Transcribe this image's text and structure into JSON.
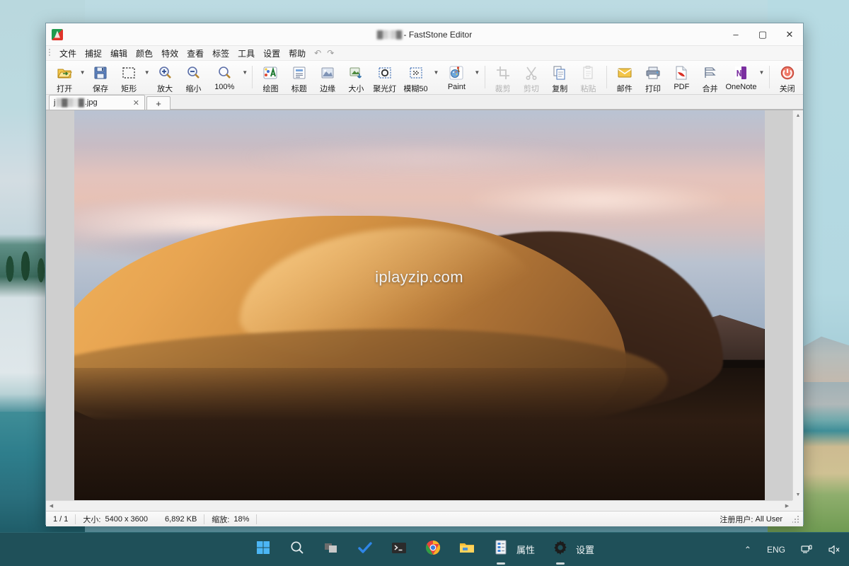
{
  "window": {
    "title_prefix_blurred": "▓▒░▒▓",
    "title": "- FastStone Editor",
    "app_icon": "faststone-logo-icon",
    "minimize": "–",
    "maximize": "▢",
    "close": "✕"
  },
  "menubar": {
    "items": [
      {
        "label": "文件",
        "name": "menu-file"
      },
      {
        "label": "捕捉",
        "name": "menu-capture"
      },
      {
        "label": "编辑",
        "name": "menu-edit"
      },
      {
        "label": "颜色",
        "name": "menu-color"
      },
      {
        "label": "特效",
        "name": "menu-effects"
      },
      {
        "label": "查看",
        "name": "menu-view"
      },
      {
        "label": "标签",
        "name": "menu-tabs"
      },
      {
        "label": "工具",
        "name": "menu-tools"
      },
      {
        "label": "设置",
        "name": "menu-settings"
      },
      {
        "label": "帮助",
        "name": "menu-help"
      }
    ],
    "undo": "↶",
    "redo": "↷"
  },
  "toolbar": {
    "items": [
      {
        "label": "打开",
        "icon": "open-folder-icon",
        "caret": true,
        "disabled": false
      },
      {
        "label": "保存",
        "icon": "save-disk-icon",
        "caret": false,
        "disabled": false
      },
      {
        "label": "矩形",
        "icon": "rectangle-select-icon",
        "caret": true,
        "disabled": false
      },
      {
        "label": "放大",
        "icon": "zoom-in-icon",
        "caret": false,
        "disabled": false
      },
      {
        "label": "缩小",
        "icon": "zoom-out-icon",
        "caret": false,
        "disabled": false
      },
      {
        "label": "100%",
        "icon": "zoom-actual-icon",
        "caret": true,
        "disabled": false
      },
      {
        "sep": true
      },
      {
        "label": "绘图",
        "icon": "draw-icon",
        "caret": false,
        "disabled": false
      },
      {
        "label": "标题",
        "icon": "caption-icon",
        "caret": false,
        "disabled": false
      },
      {
        "label": "边缘",
        "icon": "edge-icon",
        "caret": false,
        "disabled": false
      },
      {
        "label": "大小",
        "icon": "resize-icon",
        "caret": false,
        "disabled": false
      },
      {
        "label": "聚光灯",
        "icon": "spotlight-icon",
        "caret": false,
        "disabled": false
      },
      {
        "label": "模糊50",
        "icon": "blur-icon",
        "caret": true,
        "disabled": false
      },
      {
        "label": "Paint",
        "icon": "paint-icon",
        "caret": true,
        "disabled": false
      },
      {
        "sep": true
      },
      {
        "label": "裁剪",
        "icon": "crop-icon",
        "caret": false,
        "disabled": true
      },
      {
        "label": "剪切",
        "icon": "cut-scissors-icon",
        "caret": false,
        "disabled": true
      },
      {
        "label": "复制",
        "icon": "copy-icon",
        "caret": false,
        "disabled": false
      },
      {
        "label": "粘贴",
        "icon": "paste-icon",
        "caret": false,
        "disabled": true
      },
      {
        "sep": true
      },
      {
        "label": "邮件",
        "icon": "mail-envelope-icon",
        "caret": false,
        "disabled": false
      },
      {
        "label": "打印",
        "icon": "printer-icon",
        "caret": false,
        "disabled": false
      },
      {
        "label": "PDF",
        "icon": "pdf-icon",
        "caret": false,
        "disabled": false
      },
      {
        "label": "合并",
        "icon": "merge-icon",
        "caret": false,
        "disabled": false
      },
      {
        "label": "OneNote",
        "icon": "onenote-icon",
        "caret": true,
        "disabled": false
      },
      {
        "sep": true
      },
      {
        "label": "关闭",
        "icon": "power-close-icon",
        "caret": false,
        "disabled": false
      }
    ]
  },
  "tabs": {
    "open_tab": {
      "name_start": "j",
      "name_blurred": "▒▓▒░▓",
      "name_end": ".jpg",
      "close": "✕"
    },
    "add_label": "+"
  },
  "image": {
    "watermark": "iplayzip.com",
    "alt_description": "desert-sand-dune-at-dusk"
  },
  "statusbar": {
    "page": "1 / 1",
    "size_label": "大小:",
    "size_value": "5400 x 3600",
    "filesize": "6,892 KB",
    "zoom_label": "缩放:",
    "zoom_value": "18%",
    "user_label": "注册用户:",
    "user_value": "All User"
  },
  "taskbar": {
    "apps": [
      {
        "name": "start-button",
        "icon": "windows-logo-icon",
        "label": "",
        "running": false
      },
      {
        "name": "search-button",
        "icon": "search-icon",
        "label": "",
        "running": false
      },
      {
        "name": "task-view-button",
        "icon": "task-view-icon",
        "label": "",
        "running": false
      },
      {
        "name": "todo-app",
        "icon": "checkmark-icon",
        "label": "",
        "running": false
      },
      {
        "name": "terminal-app",
        "icon": "terminal-icon",
        "label": "",
        "running": false
      },
      {
        "name": "chrome-app",
        "icon": "chrome-icon",
        "label": "",
        "running": false
      },
      {
        "name": "file-explorer-app",
        "icon": "folder-icon",
        "label": "",
        "running": false
      },
      {
        "name": "properties-app",
        "icon": "properties-icon",
        "label": "属性",
        "running": true
      },
      {
        "name": "settings-app",
        "icon": "gear-icon",
        "label": "设置",
        "running": true
      }
    ],
    "tray": {
      "overflow": "⌃",
      "language": "ENG",
      "network": "network-icon",
      "volume": "volume-muted-icon"
    }
  },
  "colors": {
    "taskbar_bg": "#1f5059",
    "window_chrome": "#f0f0f0",
    "canvas_bg": "#cfcfcf",
    "accent": "#0078d4"
  }
}
